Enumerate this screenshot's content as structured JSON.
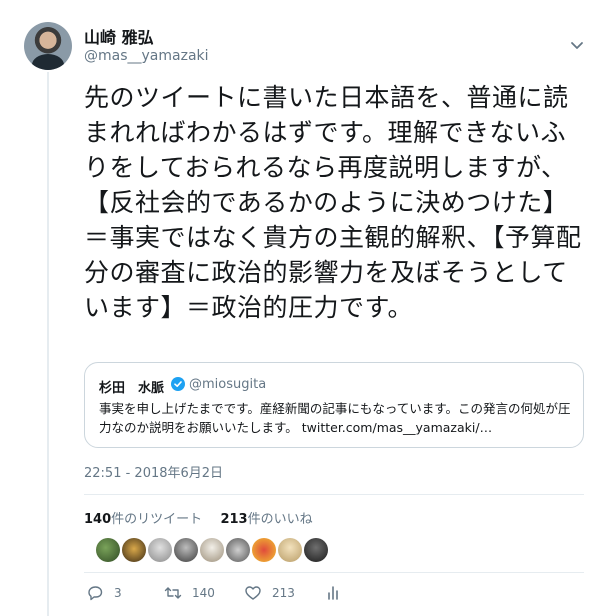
{
  "author": {
    "name": "山崎 雅弘",
    "handle": "@mas__yamazaki"
  },
  "tweet": {
    "text": "先のツイートに書いた日本語を、普通に読まれればわかるはずです。理解できないふりをしておられるなら再度説明しますが、【反社会的であるかのように決めつけた】＝事実ではなく貴方の主観的解釈、【予算配分の審査に政治的影響力を及ぼそうとしています】＝政治的圧力です。"
  },
  "quote": {
    "name": "杉田　水脈",
    "handle": "@miosugita",
    "text": "事実を申し上げたまでです。産経新聞の記事にもなっています。この発言の何処が圧力なのか説明をお願いいたします。 twitter.com/mas__yamazaki/…"
  },
  "timestamp": "22:51 - 2018年6月2日",
  "stats": {
    "retweets_count": "140",
    "retweets_label": "件のリツイート",
    "likes_count": "213",
    "likes_label": "件のいいね"
  },
  "actions": {
    "reply_count": "3",
    "retweet_count": "140",
    "like_count": "213"
  },
  "colors": {
    "verified": "#1da1f2",
    "secondary_text": "#657786",
    "border": "#ccd6dd"
  },
  "icons": [
    "chevron-down-icon",
    "verified-icon",
    "reply-icon",
    "retweet-icon",
    "heart-icon",
    "analytics-icon"
  ]
}
